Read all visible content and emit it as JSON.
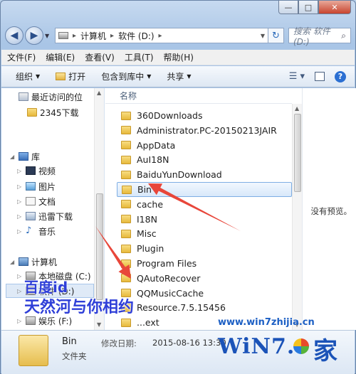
{
  "window": {
    "caption": {
      "minimize": "—",
      "maximize": "□",
      "close": "✕"
    }
  },
  "address": {
    "path": [
      "计算机",
      "软件 (D:)"
    ],
    "search_placeholder": "搜索 软件 (D:)"
  },
  "menu": [
    "文件(F)",
    "编辑(E)",
    "查看(V)",
    "工具(T)",
    "帮助(H)"
  ],
  "toolbar": {
    "organize": "组织",
    "open": "打开",
    "include_library": "包含到库中",
    "share": "共享"
  },
  "nav": {
    "recent": "最近访问的位",
    "folder_2345": "2345下载",
    "library": "库",
    "videos": "视频",
    "pictures": "图片",
    "documents": "文档",
    "xunlei": "迅雷下载",
    "music": "音乐",
    "computer": "计算机",
    "local_disk": "本地磁盘 (C:)",
    "soft_d": "软件 (D:)",
    "ent_f": "娱乐 (F:)"
  },
  "files": {
    "column_name": "名称",
    "items": [
      "360Downloads",
      "Administrator.PC-20150213JAIR",
      "AppData",
      "AuI18N",
      "BaiduYunDownload",
      "Bin",
      "cache",
      "I18N",
      "Misc",
      "Plugin",
      "Program Files",
      "QAutoRecover",
      "QQMusicCache",
      "Resource.7.5.15456",
      "...ext"
    ],
    "selected": "Bin"
  },
  "preview": {
    "empty_text": "没有预览。"
  },
  "details": {
    "name": "Bin",
    "type": "文件夹",
    "date_label": "修改日期:",
    "date_value": "2015-08-16 13:30"
  },
  "overlay": {
    "line1": "百度id",
    "line2": "天然河与你相约",
    "url": "www.win7zhijia.cn",
    "logo_text": "WiN7.",
    "logo_cn": "家",
    "arrow_color": "#e8463a"
  },
  "icons": {
    "back": "arrow-left-icon",
    "forward": "arrow-right-icon",
    "refresh": "refresh-icon",
    "search": "search-icon",
    "help": "help-icon"
  }
}
